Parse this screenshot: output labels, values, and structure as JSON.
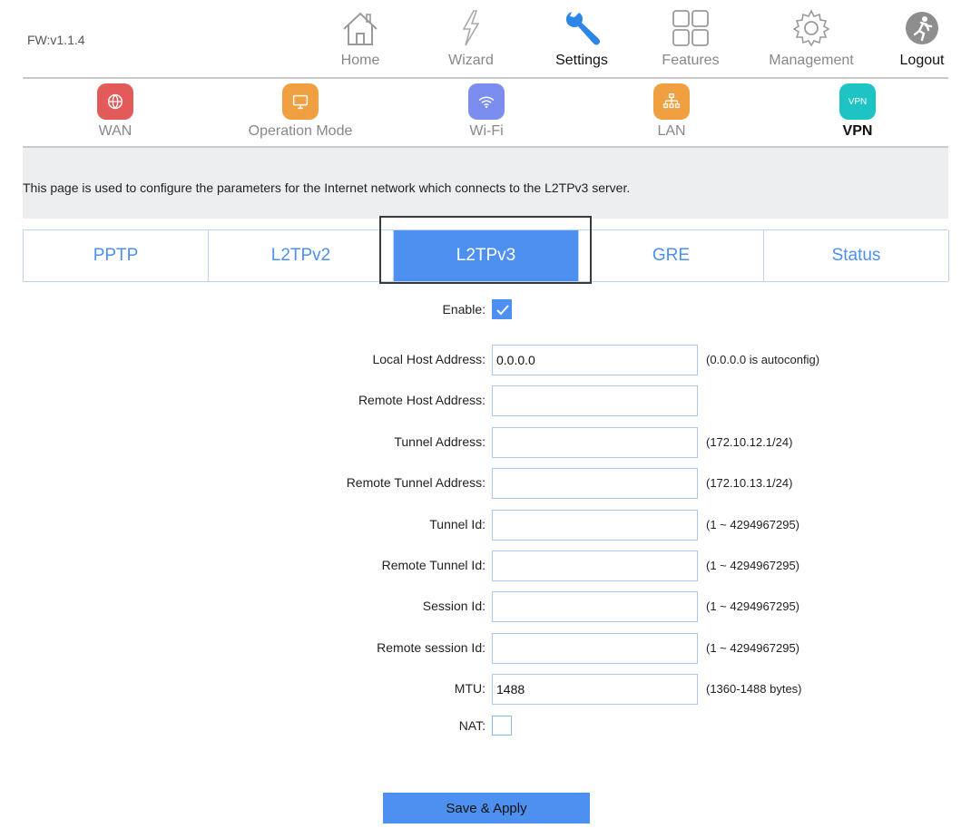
{
  "header": {
    "firmware": "FW:v1.1.4",
    "nav": [
      {
        "label": "Home",
        "icon": "home-icon"
      },
      {
        "label": "Wizard",
        "icon": "wizard-icon"
      },
      {
        "label": "Settings",
        "icon": "wrench-icon",
        "active": true
      },
      {
        "label": "Features",
        "icon": "grid-icon"
      },
      {
        "label": "Management",
        "icon": "gear-icon"
      },
      {
        "label": "Logout",
        "icon": "logout-icon"
      }
    ]
  },
  "subnav": [
    {
      "label": "WAN",
      "icon": "globe-icon",
      "color": "#e35a5a"
    },
    {
      "label": "Operation Mode",
      "icon": "monitor-icon",
      "color": "#f0a040"
    },
    {
      "label": "Wi-Fi",
      "icon": "wifi-icon",
      "color": "#7b8ef0"
    },
    {
      "label": "LAN",
      "icon": "network-icon",
      "color": "#f0a040"
    },
    {
      "label": "VPN",
      "icon": "vpn-icon",
      "icon_text": "VPN",
      "color": "#1ec4c4",
      "active": true
    }
  ],
  "info_text": "This page is used to configure the parameters for the Internet network which connects to the L2TPv3 server.",
  "tabs": [
    {
      "label": "PPTP"
    },
    {
      "label": "L2TPv2"
    },
    {
      "label": "L2TPv3",
      "active": true
    },
    {
      "label": "GRE"
    },
    {
      "label": "Status"
    }
  ],
  "form": {
    "enable_label": "Enable:",
    "enable_checked": true,
    "fields": [
      {
        "label": "Local Host Address:",
        "value": "0.0.0.0",
        "hint": "(0.0.0.0 is autoconfig)"
      },
      {
        "label": "Remote Host Address:",
        "value": "",
        "hint": ""
      },
      {
        "label": "Tunnel Address:",
        "value": "",
        "hint": "(172.10.12.1/24)"
      },
      {
        "label": "Remote Tunnel Address:",
        "value": "",
        "hint": "(172.10.13.1/24)"
      },
      {
        "label": "Tunnel Id:",
        "value": "",
        "hint": "(1 ~ 4294967295)"
      },
      {
        "label": "Remote Tunnel Id:",
        "value": "",
        "hint": "(1 ~ 4294967295)"
      },
      {
        "label": "Session Id:",
        "value": "",
        "hint": "(1 ~ 4294967295)"
      },
      {
        "label": "Remote session Id:",
        "value": "",
        "hint": "(1 ~ 4294967295)"
      },
      {
        "label": "MTU:",
        "value": "1488",
        "hint": "(1360-1488 bytes)"
      }
    ],
    "nat_label": "NAT:",
    "nat_checked": false,
    "save_label": "Save & Apply"
  },
  "colors": {
    "accent": "#4d90f0"
  }
}
